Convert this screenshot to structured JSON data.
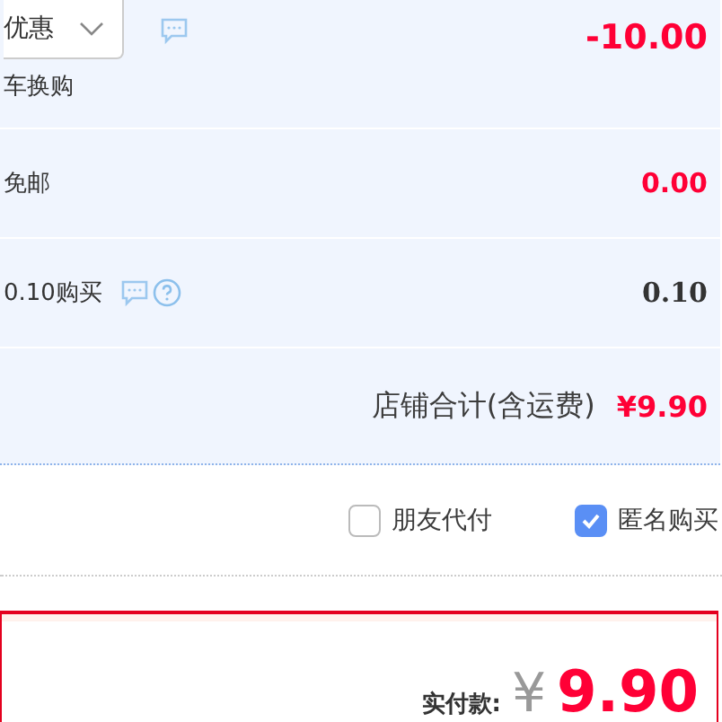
{
  "rows": [
    {
      "kind": "promo",
      "dropdown": "优惠",
      "note": "车换购",
      "amount": "-10.00"
    },
    {
      "kind": "shipping",
      "label": "免邮",
      "amount": "0.00"
    },
    {
      "kind": "addon",
      "label": "0.10购买",
      "amount": "0.10"
    }
  ],
  "subtotal": {
    "label": "店铺合计(含运费)",
    "amount": "¥9.90"
  },
  "options": [
    {
      "label": "朋友代付",
      "checked": false
    },
    {
      "label": "匿名购买",
      "checked": true
    }
  ],
  "payment": {
    "label": "实付款:",
    "currency": "¥",
    "amount": "9.90"
  }
}
